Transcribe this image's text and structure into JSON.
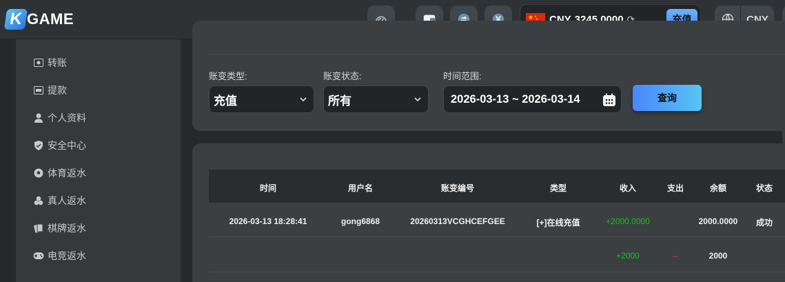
{
  "header": {
    "logo_letter": "K",
    "logo_text": "GAME",
    "wallet": {
      "currency": "CNY",
      "amount": "3245.0000",
      "deposit_label": "充值"
    },
    "language_code": "CNY"
  },
  "sidebar": {
    "items": [
      {
        "label": "转账",
        "icon": "transfer-icon"
      },
      {
        "label": "提款",
        "icon": "withdraw-icon"
      },
      {
        "label": "个人资料",
        "icon": "user-icon"
      },
      {
        "label": "安全中心",
        "icon": "shield-icon"
      },
      {
        "label": "体育返水",
        "icon": "soccer-icon"
      },
      {
        "label": "真人返水",
        "icon": "chips-icon"
      },
      {
        "label": "棋牌返水",
        "icon": "cards-icon"
      },
      {
        "label": "电竞返水",
        "icon": "gamepad-icon"
      }
    ]
  },
  "filters": {
    "type_label": "账变类型:",
    "type_value": "充值",
    "status_label": "账变状态:",
    "status_value": "所有",
    "time_label": "时间范围:",
    "time_value": "2026-03-13 ~ 2026-03-14",
    "query_label": "查询"
  },
  "table": {
    "columns": [
      "时间",
      "用户名",
      "账变编号",
      "类型",
      "收入",
      "支出",
      "余额",
      "状态"
    ],
    "rows": [
      {
        "time": "2026-03-13 18:28:41",
        "username": "gong6868",
        "order_no": "20260313VCGHCEFGEE",
        "type": "[+]在线充值",
        "income": "+2000.0000",
        "expense": "",
        "balance": "2000.0000",
        "status": "成功"
      }
    ],
    "summary": {
      "income": "+2000",
      "expense": "--",
      "balance": "2000"
    }
  },
  "colors": {
    "income": "#1bc21b",
    "expense": "#e03a3a",
    "accent": "#4a86ff"
  }
}
